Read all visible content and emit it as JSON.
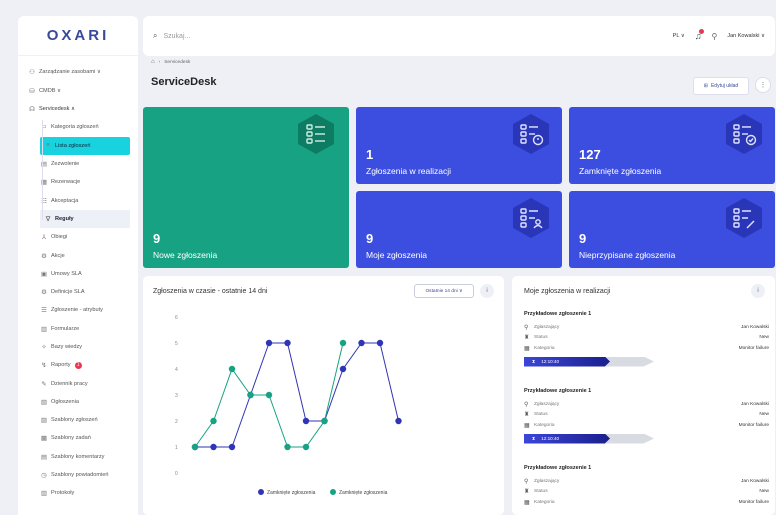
{
  "app": {
    "logo": "OXARI"
  },
  "sidebar": {
    "items": [
      {
        "label": "Zarządzanie zasobami ∨",
        "icon": "people-icon",
        "kind": "top"
      },
      {
        "label": "CMDB ∨",
        "icon": "database-icon",
        "kind": "top"
      },
      {
        "label": "Servicedesk ∧",
        "icon": "headset-icon",
        "kind": "group"
      },
      {
        "label": "Kategoria zgłoszeń",
        "icon": "tag-icon",
        "kind": "sub"
      },
      {
        "label": "Lista zgłoszeń",
        "icon": "list-icon",
        "kind": "active"
      },
      {
        "label": "Zezwolenie",
        "icon": "doc-icon",
        "kind": "sub"
      },
      {
        "label": "Rezerwacje",
        "icon": "calendar-icon",
        "kind": "sub"
      },
      {
        "label": "Akceptacja",
        "icon": "check-list-icon",
        "kind": "sub"
      },
      {
        "label": "Reguły",
        "icon": "filter-icon",
        "kind": "selected"
      },
      {
        "label": "Obiegi",
        "icon": "flow-icon",
        "kind": "sub"
      },
      {
        "label": "Akcje",
        "icon": "cog-icon",
        "kind": "sub"
      },
      {
        "label": "Umowy SLA",
        "icon": "contract-icon",
        "kind": "sub"
      },
      {
        "label": "Definicje SLA",
        "icon": "gear-icon",
        "kind": "sub"
      },
      {
        "label": "Zgłoszenie - atrybuty",
        "icon": "sliders-icon",
        "kind": "sub"
      },
      {
        "label": "Formularze",
        "icon": "form-icon",
        "kind": "sub"
      },
      {
        "label": "Bazy wiedzy",
        "icon": "bulb-icon",
        "kind": "sub"
      },
      {
        "label": "Raporty",
        "icon": "report-icon",
        "kind": "sub",
        "badge": "1"
      },
      {
        "label": "Dziennik pracy",
        "icon": "journal-icon",
        "kind": "sub"
      },
      {
        "label": "Ogłoszenia",
        "icon": "megaphone-icon",
        "kind": "sub"
      },
      {
        "label": "Szablony zgłoszeń",
        "icon": "template-icon",
        "kind": "sub"
      },
      {
        "label": "Szablony zadań",
        "icon": "task-template-icon",
        "kind": "sub"
      },
      {
        "label": "Szablony komentarzy",
        "icon": "comment-template-icon",
        "kind": "sub"
      },
      {
        "label": "Szablony powiadomień",
        "icon": "notification-template-icon",
        "kind": "sub"
      },
      {
        "label": "Protokoły",
        "icon": "protocol-icon",
        "kind": "sub"
      }
    ]
  },
  "topbar": {
    "search_placeholder": "Szukaj...",
    "language": "PL ∨",
    "user": "Jan Kowalski ∨"
  },
  "header": {
    "breadcrumb": "Servicedesk",
    "title": "ServiceDesk",
    "edit_label": "Edytuj układ",
    "kebab": "⋮"
  },
  "tiles": [
    {
      "num": "9",
      "label": "Nowe zgłoszenia",
      "color": "#17a383"
    },
    {
      "num": "1",
      "label": "Zgłoszenia w realizacji",
      "color": "#3c4ee0"
    },
    {
      "num": "127",
      "label": "Zamknięte zgłoszenia",
      "color": "#3c4ee0"
    },
    {
      "num": "9",
      "label": "Moje zgłoszenia",
      "color": "#3c4ee0"
    },
    {
      "num": "9",
      "label": "Nieprzypisane zgłoszenia",
      "color": "#3c4ee0"
    }
  ],
  "chart_panel": {
    "title": "Zgłoszenia w czasie - ostatnie 14 dni",
    "range_label": "Ostatnie 14 dni ∨",
    "info": "i"
  },
  "chart_data": {
    "type": "line",
    "x": [
      1,
      2,
      3,
      4,
      5,
      6,
      7,
      8,
      9,
      10,
      11,
      12,
      13,
      14
    ],
    "ylim": [
      0,
      6
    ],
    "yticks": [
      "0",
      "1",
      "2",
      "3",
      "4",
      "5",
      "6"
    ],
    "grid": false,
    "legend": "bottom",
    "series": [
      {
        "name": "Zamknięte zgłoszenia",
        "color": "#2f35b5",
        "values": [
          1,
          1,
          1,
          3,
          5,
          5,
          2,
          2,
          4,
          5,
          5,
          2
        ]
      },
      {
        "name": "Zamknięte zgłoszenia",
        "color": "#17a383",
        "values": [
          1,
          2,
          4,
          3,
          3,
          1,
          1,
          2,
          5
        ]
      }
    ]
  },
  "my_tickets": {
    "title": "Moje zgłoszenia w realizacji",
    "info": "i",
    "cards": [
      {
        "title": "Przykładowe zgłoszenie 1",
        "requester_label": "Zgłaszający",
        "requester": "Jan Kowalski",
        "status_label": "Status",
        "status": "New",
        "category_label": "Kategoria",
        "category": "Monitor failure",
        "timer": "12:10:40"
      },
      {
        "title": "Przykładowe zgłoszenie 1",
        "requester_label": "Zgłaszający",
        "requester": "Jan Kowalski",
        "status_label": "Status",
        "status": "New",
        "category_label": "Kategoria",
        "category": "Monitor failure",
        "timer": "12:10:40"
      },
      {
        "title": "Przykładowe zgłoszenie 1",
        "requester_label": "Zgłaszający",
        "requester": "Jan Kowalski",
        "status_label": "Status",
        "status": "New",
        "category_label": "Kategoria",
        "category": "Monitor failure"
      }
    ]
  }
}
